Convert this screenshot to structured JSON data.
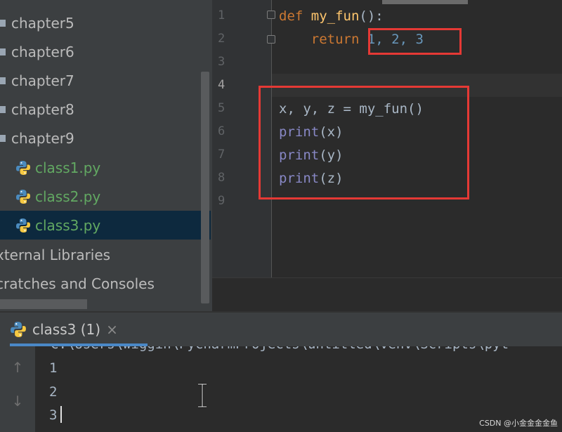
{
  "project_tree": {
    "items": [
      {
        "label": "chapter5",
        "kind": "folder"
      },
      {
        "label": "chapter6",
        "kind": "folder"
      },
      {
        "label": "chapter7",
        "kind": "folder"
      },
      {
        "label": "chapter8",
        "kind": "folder"
      },
      {
        "label": "chapter9",
        "kind": "folder"
      },
      {
        "label": "class1.py",
        "kind": "python-file"
      },
      {
        "label": "class2.py",
        "kind": "python-file"
      },
      {
        "label": "class3.py",
        "kind": "python-file",
        "selected": true
      },
      {
        "label": "xternal Libraries",
        "kind": "root"
      },
      {
        "label": "cratches and Consoles",
        "kind": "root"
      }
    ]
  },
  "editor": {
    "current_line": 4,
    "line_numbers": [
      "1",
      "2",
      "3",
      "4",
      "5",
      "6",
      "7",
      "8",
      "9"
    ],
    "code": {
      "l1_kw": "def",
      "l1_fn": "my_fun",
      "l1_rest": "():",
      "l2_kw": "return",
      "l2_vals": "1, 2, 3",
      "l5": "x, y, z = my_fun()",
      "l6_fn": "print",
      "l6_arg": "(x)",
      "l7_fn": "print",
      "l7_arg": "(y)",
      "l8_fn": "print",
      "l8_arg": "(z)"
    }
  },
  "run_panel": {
    "tab_label": "class3 (1)",
    "tab_close": "×",
    "command_line": "C:\\Users\\wiggin\\PycharmProjects\\untitled\\venv\\Scripts\\pyt",
    "output": [
      "1",
      "2",
      "3"
    ]
  },
  "watermark": "CSDN @小金金金金鱼",
  "colors": {
    "highlight_box": "#e53935",
    "selection": "#0d293e",
    "python_file": "#62a862",
    "keyword": "#cc7832",
    "function": "#ffc66d",
    "number": "#6897bb",
    "builtin": "#8888c6"
  },
  "icons": [
    "folder-icon",
    "python-file-icon",
    "fold-icon",
    "arrow-up-icon",
    "arrow-down-icon",
    "close-icon",
    "ibeam-cursor-icon"
  ]
}
